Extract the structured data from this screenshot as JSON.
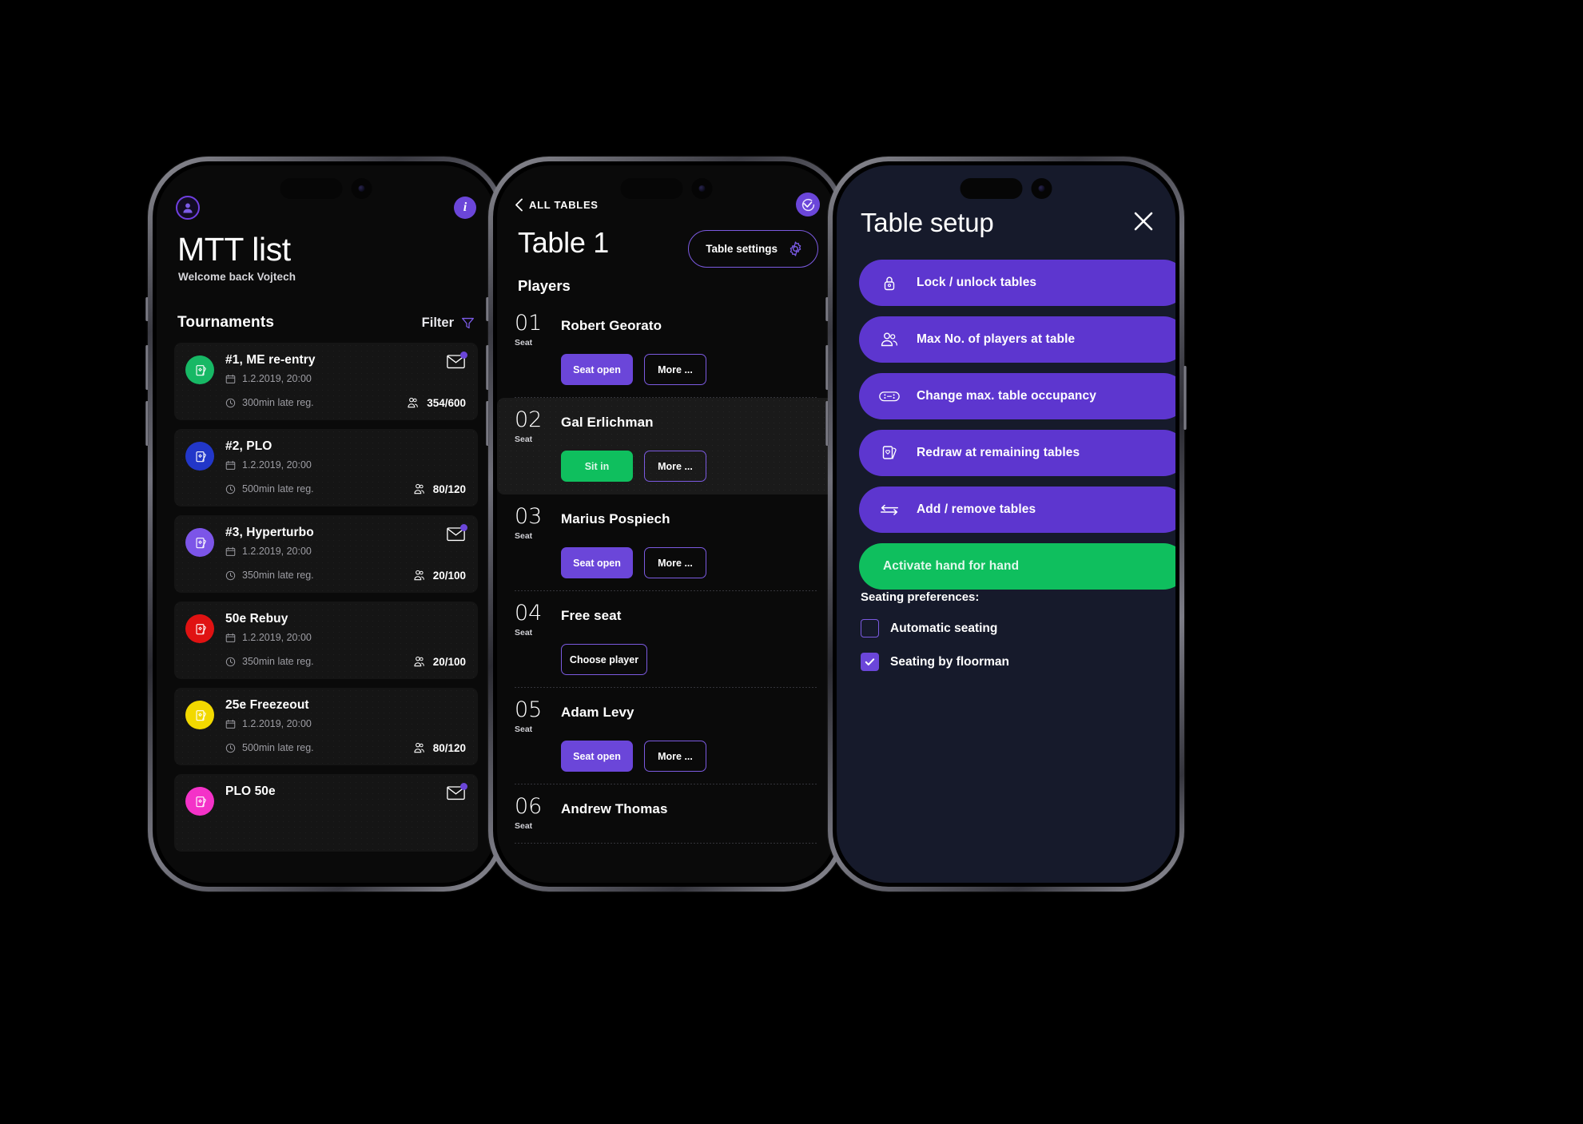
{
  "phone1": {
    "top_icons": {
      "avatar": "avatar-icon",
      "info": "i"
    },
    "title": "MTT list",
    "subtitle": "Welcome back Vojtech",
    "section_title": "Tournaments",
    "filter_label": "Filter",
    "tournaments": [
      {
        "name": "#1, ME re-entry",
        "date": "1.2.2019, 20:00",
        "late_reg": "300min late reg.",
        "players": "354/600",
        "color": "#17b865",
        "mail": true,
        "mail_badge": true
      },
      {
        "name": "#2, PLO",
        "date": "1.2.2019, 20:00",
        "late_reg": "500min late reg.",
        "players": "80/120",
        "color": "#2237c9",
        "mail": false,
        "mail_badge": false
      },
      {
        "name": "#3, Hyperturbo",
        "date": "1.2.2019, 20:00",
        "late_reg": "350min late reg.",
        "players": "20/100",
        "color": "#7c55e8",
        "mail": true,
        "mail_badge": true
      },
      {
        "name": "50e Rebuy",
        "date": "1.2.2019, 20:00",
        "late_reg": "350min late reg.",
        "players": "20/100",
        "color": "#e01212",
        "mail": false,
        "mail_badge": false
      },
      {
        "name": "25e Freezeout",
        "date": "1.2.2019, 20:00",
        "late_reg": "500min late reg.",
        "players": "80/120",
        "color": "#f2d900",
        "mail": false,
        "mail_badge": false
      },
      {
        "name": "PLO 50e",
        "date": "",
        "late_reg": "",
        "players": "",
        "color": "#f432c8",
        "mail": true,
        "mail_badge": true
      }
    ]
  },
  "phone2": {
    "back_label": "ALL TABLES",
    "refresh_icon": "timer-check-icon",
    "title": "Table 1",
    "settings_label": "Table settings",
    "players_heading": "Players",
    "seat_word": "Seat",
    "seats": [
      {
        "num": "01",
        "name": "Robert Georato",
        "action": "Seat open",
        "action_style": "primary",
        "more": "More ...",
        "active": false
      },
      {
        "num": "02",
        "name": "Gal Erlichman",
        "action": "Sit in",
        "action_style": "green",
        "more": "More ...",
        "active": true
      },
      {
        "num": "03",
        "name": "Marius Pospiech",
        "action": "Seat open",
        "action_style": "primary",
        "more": "More ...",
        "active": false
      },
      {
        "num": "04",
        "name": "Free seat",
        "action": "Choose player",
        "action_style": "choose",
        "more": "",
        "active": false
      },
      {
        "num": "05",
        "name": "Adam Levy",
        "action": "Seat open",
        "action_style": "primary",
        "more": "More ...",
        "active": false
      },
      {
        "num": "06",
        "name": "Andrew Thomas",
        "action": "",
        "action_style": "none",
        "more": "",
        "active": false
      }
    ]
  },
  "phone3": {
    "title": "Table setup",
    "close_icon": "close-icon",
    "menu": [
      {
        "label": "Lock / unlock tables",
        "icon": "lock-icon",
        "style": "purple"
      },
      {
        "label": "Max No. of players at table",
        "icon": "people-icon",
        "style": "purple"
      },
      {
        "label": "Change max. table occupancy",
        "icon": "table-icon",
        "style": "purple"
      },
      {
        "label": "Redraw at remaining tables",
        "icon": "cards-icon",
        "style": "purple"
      },
      {
        "label": "Add / remove tables",
        "icon": "arrows-icon",
        "style": "purple"
      },
      {
        "label": "Activate hand for hand",
        "icon": "none",
        "style": "green"
      }
    ],
    "prefs_title": "Seating preferences:",
    "prefs": [
      {
        "label": "Automatic seating",
        "checked": false
      },
      {
        "label": "Seating by floorman",
        "checked": true
      }
    ]
  },
  "colors": {
    "purple": "#6b46d9",
    "menu_purple": "#5d36cf",
    "green": "#0fbf5e",
    "navy": "#161a2b",
    "dark": "#0a0a0a"
  }
}
